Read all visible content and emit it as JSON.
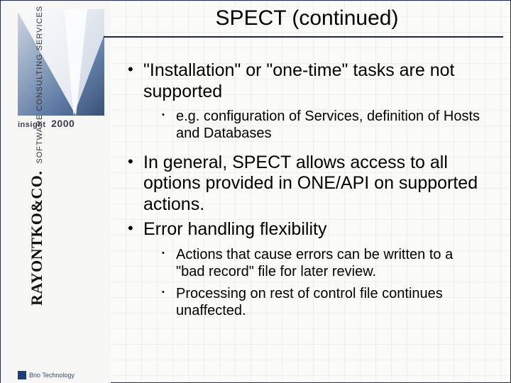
{
  "title": "SPECT (continued)",
  "sidebar": {
    "insight_label": "insight",
    "insight_year": "2000",
    "brand_line1": "RAYONTKO&CO.",
    "brand_line2": "SOFTWARE CONSULTING SERVICES",
    "footer_brand": "Brio Technology"
  },
  "bullets": [
    {
      "text": "\"Installation\" or \"one-time\" tasks are not supported",
      "sub": [
        "e.g. configuration of Services, definition of Hosts and Databases"
      ]
    },
    {
      "text": "In general, SPECT allows access to all options provided in ONE/API on supported actions.",
      "sub": []
    },
    {
      "text": "Error handling flexibility",
      "sub": [
        "Actions that cause errors can be written to a \"bad record\" file for later review.",
        "Processing on rest of control file continues unaffected."
      ]
    }
  ]
}
